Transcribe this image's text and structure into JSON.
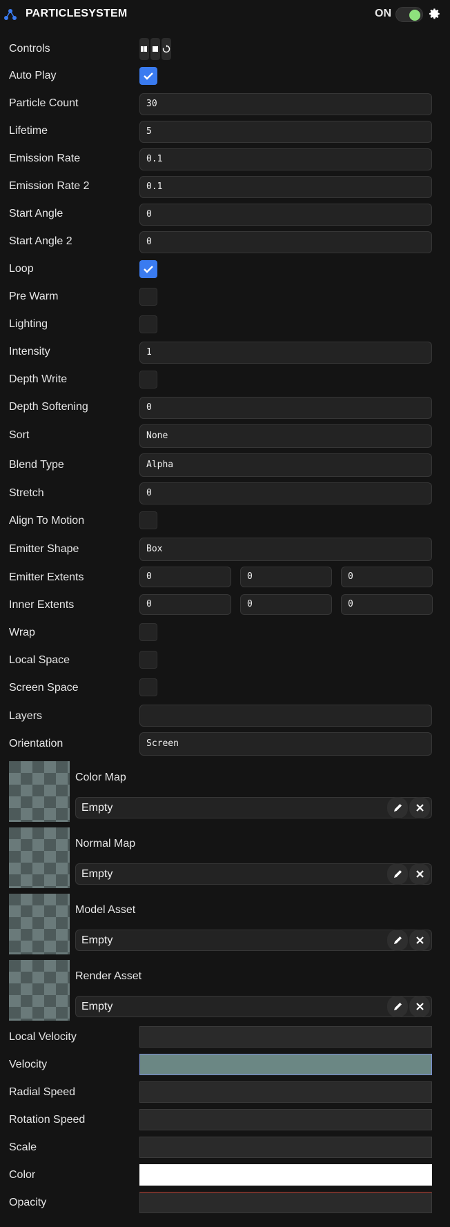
{
  "header": {
    "title": "PARTICLESYSTEM",
    "enabled_label": "ON",
    "enabled": true,
    "logo_icon": "particle-system-icon",
    "settings_icon": "gear-icon",
    "accent_color": "#3a7bf0",
    "toggle_color": "#8ee27d"
  },
  "controls": {
    "label": "Controls",
    "buttons": [
      "play-icon",
      "stop-icon",
      "reset-icon"
    ]
  },
  "fields": {
    "auto_play": {
      "label": "Auto Play",
      "checked": true
    },
    "particle_count": {
      "label": "Particle Count",
      "value": "30"
    },
    "lifetime": {
      "label": "Lifetime",
      "value": "5"
    },
    "emission_rate": {
      "label": "Emission Rate",
      "value": "0.1"
    },
    "emission_rate_2": {
      "label": "Emission Rate 2",
      "value": "0.1"
    },
    "start_angle": {
      "label": "Start Angle",
      "value": "0"
    },
    "start_angle_2": {
      "label": "Start Angle 2",
      "value": "0"
    },
    "loop": {
      "label": "Loop",
      "checked": true
    },
    "pre_warm": {
      "label": "Pre Warm",
      "checked": false
    },
    "lighting": {
      "label": "Lighting",
      "checked": false
    },
    "intensity": {
      "label": "Intensity",
      "value": "1"
    },
    "depth_write": {
      "label": "Depth Write",
      "checked": false
    },
    "depth_softening": {
      "label": "Depth Softening",
      "value": "0"
    },
    "sort": {
      "label": "Sort",
      "value": "None"
    },
    "blend_type": {
      "label": "Blend Type",
      "value": "Alpha"
    },
    "stretch": {
      "label": "Stretch",
      "value": "0"
    },
    "align_to_motion": {
      "label": "Align To Motion",
      "checked": false
    },
    "emitter_shape": {
      "label": "Emitter Shape",
      "value": "Box"
    },
    "emitter_extents": {
      "label": "Emitter Extents",
      "values": [
        "0",
        "0",
        "0"
      ]
    },
    "inner_extents": {
      "label": "Inner Extents",
      "values": [
        "0",
        "0",
        "0"
      ]
    },
    "wrap": {
      "label": "Wrap",
      "checked": false
    },
    "local_space": {
      "label": "Local Space",
      "checked": false
    },
    "screen_space": {
      "label": "Screen Space",
      "checked": false
    },
    "layers": {
      "label": "Layers",
      "value": ""
    },
    "orientation": {
      "label": "Orientation",
      "value": "Screen"
    }
  },
  "assets": [
    {
      "label": "Color Map",
      "value": "Empty"
    },
    {
      "label": "Normal Map",
      "value": "Empty"
    },
    {
      "label": "Model Asset",
      "value": "Empty"
    },
    {
      "label": "Render Asset",
      "value": "Empty"
    }
  ],
  "curves": {
    "local_velocity": {
      "label": "Local Velocity",
      "color": "#2a2a2a"
    },
    "velocity": {
      "label": "Velocity",
      "color": "#6b8784"
    },
    "radial_speed": {
      "label": "Radial Speed",
      "color": "#2a2a2a"
    },
    "rotation_speed": {
      "label": "Rotation Speed",
      "color": "#2a2a2a"
    },
    "scale": {
      "label": "Scale",
      "color": "#2a2a2a"
    },
    "color": {
      "label": "Color",
      "color": "#ffffff"
    },
    "opacity": {
      "label": "Opacity",
      "color": "#2a2a2a"
    }
  }
}
